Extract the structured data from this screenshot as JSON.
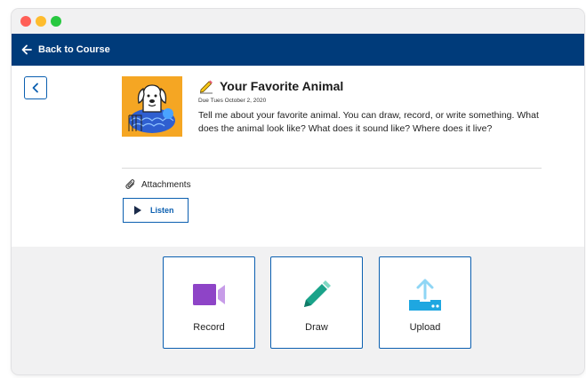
{
  "window": {
    "controls": [
      "close",
      "minimize",
      "maximize"
    ]
  },
  "nav": {
    "back_label": "Back to Course",
    "background": "#003b7a"
  },
  "assignment": {
    "title": "Your Favorite Animal",
    "due": "Due Tues October 2, 2020",
    "description": "Tell me about your favorite animal. You can draw, record, or write something. What does the animal look like? What does it sound like? Where does it live?",
    "title_icon": "pencil-icon",
    "thumbnail_icon": "dog-illustration"
  },
  "attachments": {
    "label": "Attachments",
    "icon": "paperclip-icon",
    "listen_label": "Listen"
  },
  "actions": [
    {
      "label": "Record",
      "icon": "video-camera-icon",
      "color": "#8e44c7"
    },
    {
      "label": "Draw",
      "icon": "pen-icon",
      "color": "#1aa38a"
    },
    {
      "label": "Upload",
      "icon": "upload-icon",
      "color": "#1ea7e1"
    }
  ],
  "colors": {
    "accent": "#0b5fb0",
    "panel": "#f1f1f2"
  }
}
